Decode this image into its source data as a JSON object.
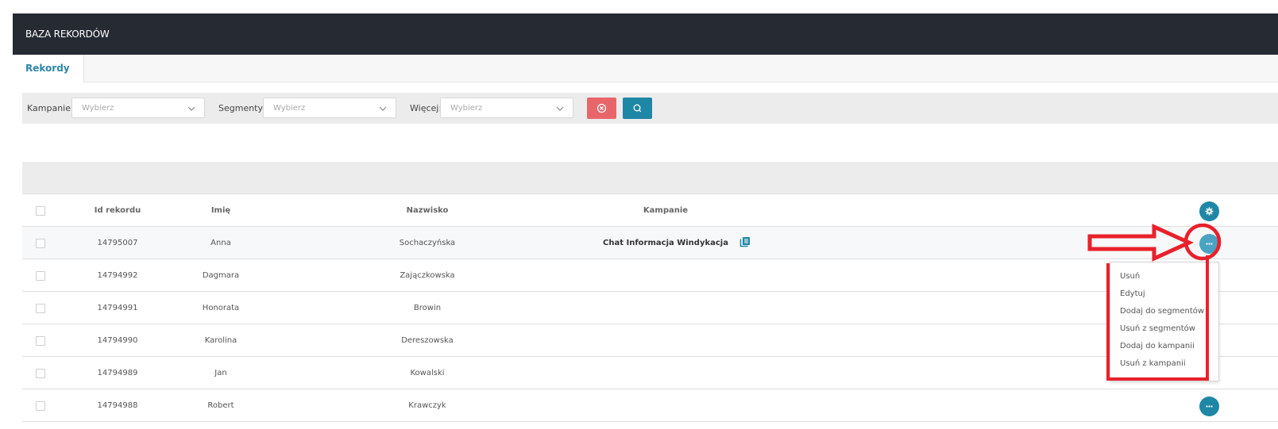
{
  "header": {
    "title": "BAZA REKORDÓW"
  },
  "tabs": [
    {
      "label": "Rekordy"
    }
  ],
  "filters": {
    "kampanie": {
      "label": "Kampanie:",
      "placeholder": "Wybierz"
    },
    "segmenty": {
      "label": "Segmenty:",
      "placeholder": "Wybierz"
    },
    "wiecej": {
      "label": "Więcej:",
      "placeholder": "Wybierz"
    }
  },
  "table": {
    "columns": [
      "Id rekordu",
      "Imię",
      "Nazwisko",
      "Kampanie"
    ],
    "rows": [
      {
        "id": "14795007",
        "imie": "Anna",
        "nazwisko": "Sochaczyńska",
        "kampanie": "Chat Informacja Windykacja"
      },
      {
        "id": "14794992",
        "imie": "Dagmara",
        "nazwisko": "Zajączkowska",
        "kampanie": ""
      },
      {
        "id": "14794991",
        "imie": "Honorata",
        "nazwisko": "Browin",
        "kampanie": ""
      },
      {
        "id": "14794990",
        "imie": "Karolina",
        "nazwisko": "Dereszowska",
        "kampanie": ""
      },
      {
        "id": "14794989",
        "imie": "Jan",
        "nazwisko": "Kowalski",
        "kampanie": ""
      },
      {
        "id": "14794988",
        "imie": "Robert",
        "nazwisko": "Krawczyk",
        "kampanie": ""
      }
    ]
  },
  "action_menu": {
    "items": [
      "Usuń",
      "Edytuj",
      "Dodaj do segmentów",
      "Usuń z segmentów",
      "Dodaj do kampanii",
      "Usuń z kampanii"
    ]
  },
  "colors": {
    "header_bg": "#262a33",
    "accent": "#1f87a6",
    "clear_button": "#e8666a",
    "annotation": "#e8212b"
  },
  "icons": {
    "clear": "circle-x-icon",
    "search": "search-icon",
    "settings": "gear-icon",
    "row_actions": "more-dots-icon",
    "copy": "copy-icon",
    "dropdown": "chevron-down-icon"
  }
}
